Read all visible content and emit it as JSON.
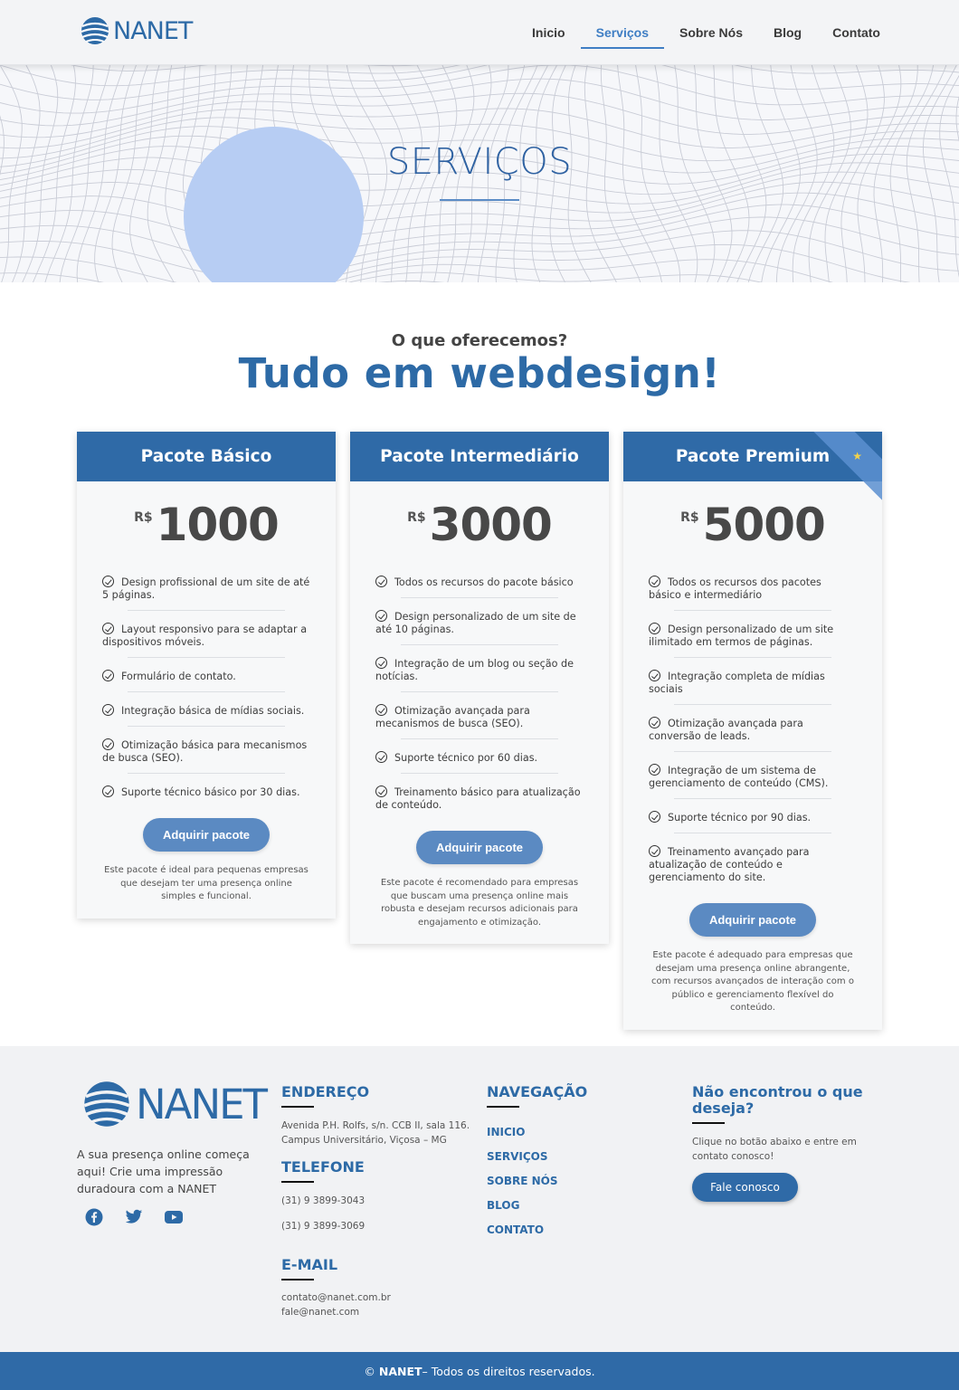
{
  "brand": {
    "name": "NANET",
    "color": "#2d6aa6"
  },
  "nav": {
    "items": [
      {
        "label": "Inicio",
        "active": false
      },
      {
        "label": "Serviços",
        "active": true
      },
      {
        "label": "Sobre Nós",
        "active": false
      },
      {
        "label": "Blog",
        "active": false
      },
      {
        "label": "Contato",
        "active": false
      }
    ]
  },
  "hero": {
    "title": "SERVIÇOS"
  },
  "section": {
    "subtitle": "O que oferecemos?",
    "title": "Tudo em webdesign!"
  },
  "packages": [
    {
      "name": "Pacote Básico",
      "currency": "R$",
      "price": "1000",
      "features": [
        "Design profissional de um site de até 5 páginas.",
        "Layout responsivo para se adaptar a dispositivos móveis.",
        "Formulário de contato.",
        "Integração básica de mídias sociais.",
        "Otimização básica para mecanismos de busca (SEO).",
        "Suporte técnico básico por 30 dias."
      ],
      "button": "Adquirir pacote",
      "description": "Este pacote é ideal para pequenas empresas que desejam ter uma presença online simples e funcional."
    },
    {
      "name": "Pacote Intermediário",
      "currency": "R$",
      "price": "3000",
      "features": [
        "Todos os recursos do pacote básico",
        "Design personalizado de um site de até 10 páginas.",
        "Integração de um blog ou seção de notícias.",
        "Otimização avançada para mecanismos de busca (SEO).",
        "Suporte técnico por 60 dias.",
        "Treinamento básico para atualização de conteúdo."
      ],
      "button": "Adquirir pacote",
      "description": "Este pacote é recomendado para empresas que buscam uma presença online mais robusta e desejam recursos adicionais para engajamento e otimização."
    },
    {
      "name": "Pacote Premium",
      "currency": "R$",
      "price": "5000",
      "features": [
        "Todos os recursos dos pacotes básico e intermediário",
        "Design personalizado de um site ilimitado em termos de páginas.",
        "Integração completa de mídias sociais",
        "Otimização avançada para conversão de leads.",
        "Integração de um sistema de gerenciamento de conteúdo (CMS).",
        "Suporte técnico por 90 dias.",
        "Treinamento avançado para atualização de conteúdo e gerenciamento do site."
      ],
      "button": "Adquirir pacote",
      "description": "Este pacote é adequado para empresas que desejam uma presença online abrangente, com recursos avançados de interação com o público e gerenciamento flexível do conteúdo."
    }
  ],
  "footer": {
    "tagline": "A sua presença online começa aqui! Crie uma impressão duradoura com a NANET",
    "social": [
      "facebook-icon",
      "twitter-icon",
      "youtube-icon"
    ],
    "address": {
      "heading": "ENDEREÇO",
      "line1": "Avenida P.H. Rolfs, s/n. CCB II, sala 116.",
      "line2": "Campus Universitário, Viçosa – MG"
    },
    "phone": {
      "heading": "TELEFONE",
      "numbers": [
        "(31) 9 3899-3043",
        "(31) 9 3899-3069"
      ]
    },
    "email": {
      "heading": "E-MAIL",
      "addresses": [
        "contato@nanet.com.br",
        "fale@nanet.com"
      ]
    },
    "navigation": {
      "heading": "NAVEGAÇÃO",
      "links": [
        "INICIO",
        "SERVIÇOS",
        "SOBRE NÓS",
        "BLOG",
        "CONTATO"
      ]
    },
    "cta": {
      "heading": "Não encontrou o que deseja?",
      "text": "Clique no botão abaixo e entre em contato conosco!",
      "button": "Fale conosco"
    },
    "copyright": {
      "symbol": "©",
      "brand": "NANET",
      "text": "– Todos os direitos reservados."
    }
  }
}
